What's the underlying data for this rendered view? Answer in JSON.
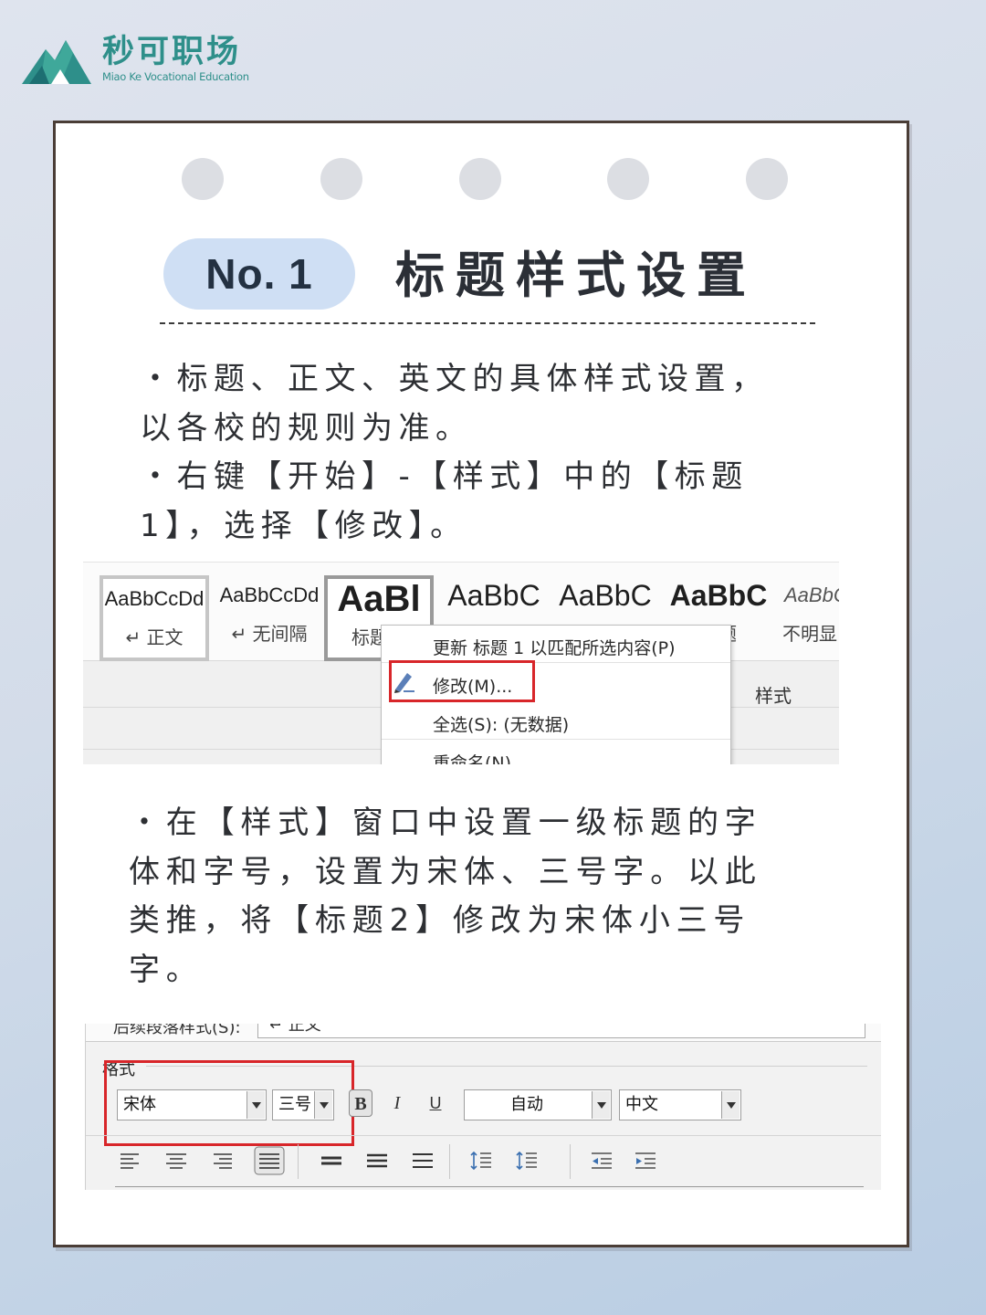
{
  "brand": {
    "name_cn": "秒可职场",
    "name_en": "Miao Ke Vocational Education",
    "color": "#2e8f8a"
  },
  "header": {
    "badge": "No. 1",
    "title": "标题样式设置"
  },
  "paragraph1": {
    "line1": "・标题、正文、英文的具体样式设置，",
    "line2": "以各校的规则为准。",
    "line3": "・右键【开始】-【样式】中的【标题",
    "line4": "1】，选择【修改】。"
  },
  "ribbon": {
    "styles": [
      {
        "sample": "AaBbCcDd",
        "name": "↵ 正文"
      },
      {
        "sample": "AaBbCcDd",
        "name": "↵ 无间隔"
      },
      {
        "sample": "AaBl",
        "name": "标题"
      },
      {
        "sample": "AaBbC",
        "name": ""
      },
      {
        "sample": "AaBbC",
        "name": ""
      },
      {
        "sample": "AaBbC",
        "name": "题"
      },
      {
        "sample": "AaBbC",
        "name": "不明显"
      }
    ],
    "group_label": "样式",
    "context_menu": {
      "update": "更新 标题 1 以匹配所选内容(P)",
      "modify": "修改(M)...",
      "select_all": "全选(S): (无数据)",
      "rename": "重命名(N)..."
    },
    "highlight_color": "#d8262a"
  },
  "paragraph2": {
    "line1": "・在【样式】窗口中设置一级标题的字",
    "line2": "体和字号，设置为宋体、三号字。以此",
    "line3": "类推，将【标题2】修改为宋体小三号",
    "line4": "字。"
  },
  "format_dialog": {
    "top_label": "后续段落样式(S):",
    "top_value": "↵ 正文",
    "section_label": "格式",
    "font": "宋体",
    "size": "三号",
    "bold": "B",
    "italic": "I",
    "underline": "U",
    "color": "自动",
    "lang": "中文"
  }
}
